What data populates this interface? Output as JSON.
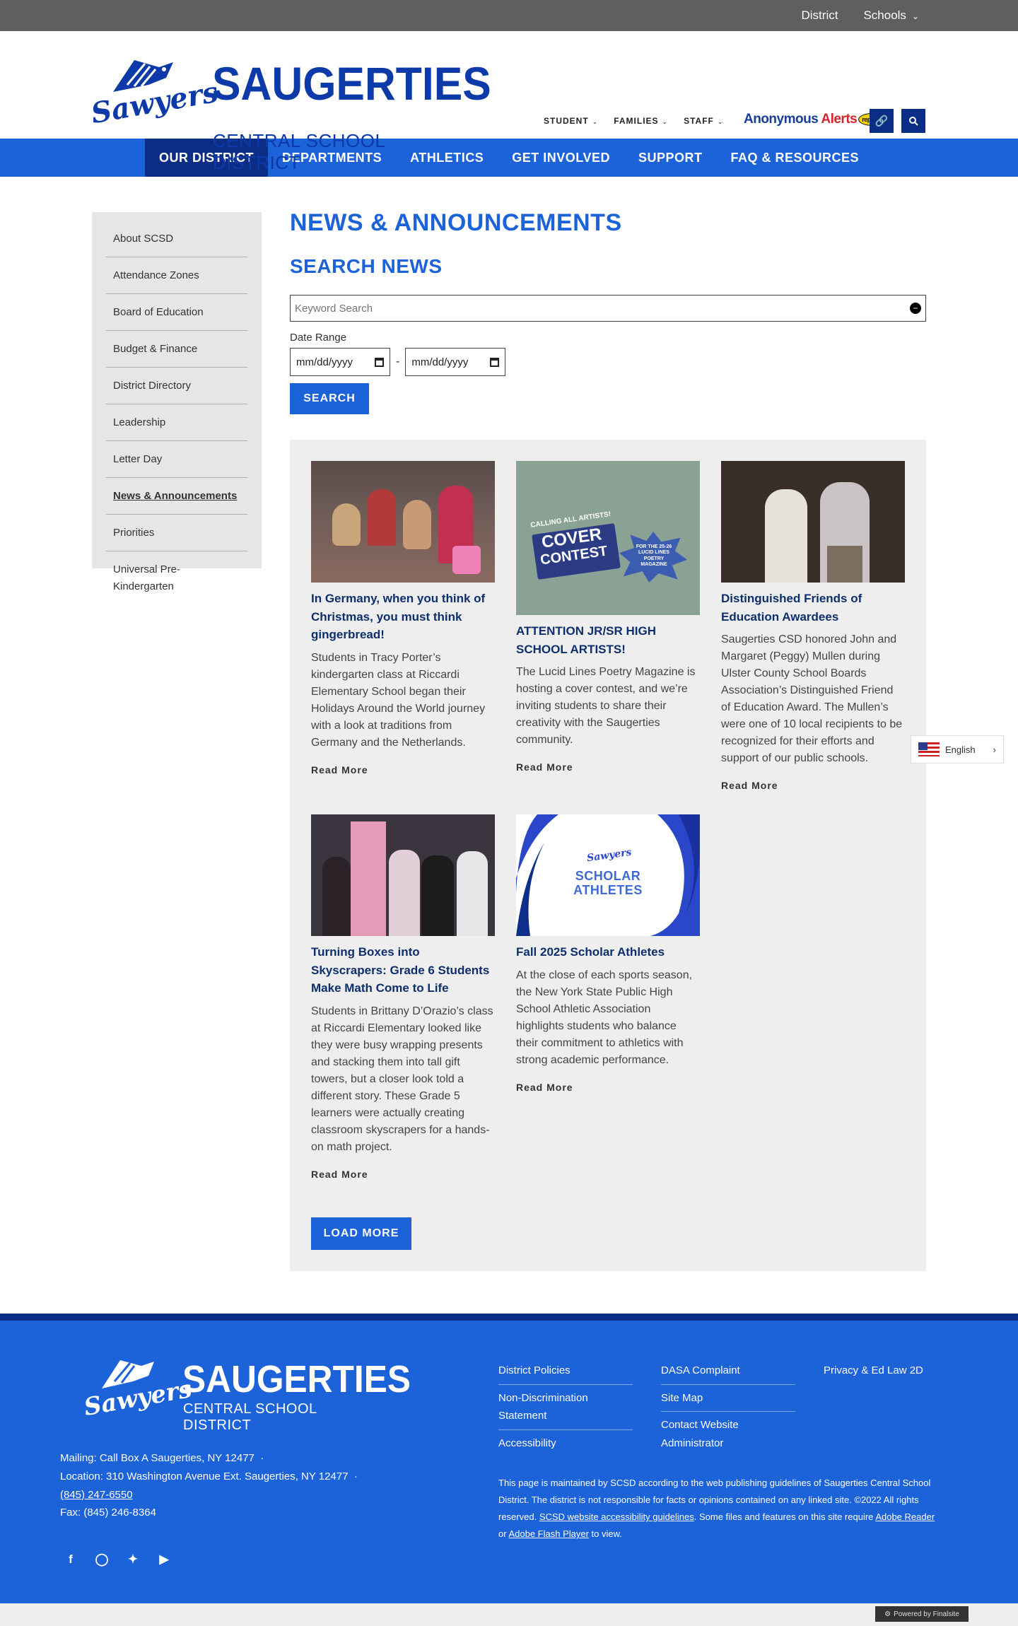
{
  "topbar": {
    "district": "District",
    "schools": "Schools"
  },
  "logo": {
    "script": "Sawyers",
    "title": "SAUGERTIES",
    "subtitle": "CENTRAL SCHOOL DISTRICT"
  },
  "header_nav": {
    "student": "STUDENT",
    "families": "FAMILIES",
    "staff": "STAFF"
  },
  "anonymous_alerts": {
    "part1": "Anonymous ",
    "part2": "Alerts",
    "badge": "report it"
  },
  "main_nav": [
    "OUR DISTRICT",
    "DEPARTMENTS",
    "ATHLETICS",
    "GET INVOLVED",
    "SUPPORT",
    "FAQ & RESOURCES"
  ],
  "sidebar": {
    "items": [
      "About SCSD",
      "Attendance Zones",
      "Board of Education",
      "Budget & Finance",
      "District Directory",
      "Leadership",
      "Letter Day",
      "News & Announcements",
      "Priorities",
      "Universal Pre-Kindergarten"
    ],
    "active_index": 7
  },
  "page": {
    "title": "NEWS & ANNOUNCEMENTS",
    "search_heading": "SEARCH NEWS"
  },
  "search": {
    "placeholder": "Keyword Search",
    "date_range_label": "Date Range",
    "date_from": "mm/dd/yyyy",
    "date_sep": "-",
    "date_to": "mm/dd/yyyy",
    "button": "SEARCH"
  },
  "news": [
    {
      "title": "In Germany, when you think of Christmas, you must think gingerbread!",
      "body": "Students in Tracy Porter’s kindergarten class at Riccardi Elementary School began their Holidays Around the World journey with a look at traditions from Germany and the Netherlands.",
      "more": "Read More"
    },
    {
      "title": "ATTENTION JR/SR HIGH SCHOOL ARTISTS!",
      "body": "The Lucid Lines Poetry Magazine is hosting a cover contest, and we’re inviting students to share their creativity with the Saugerties community.",
      "more": "Read More",
      "img_text": {
        "calling": "CALLING ALL ARTISTS!",
        "cover": "COVER",
        "contest": "CONTEST",
        "for": "FOR THE 25-26",
        "mag1": "LUCID LINES",
        "mag2": "POETRY",
        "mag3": "MAGAZINE"
      }
    },
    {
      "title": "Distinguished Friends of Education Awardees",
      "body": "Saugerties CSD honored John and Margaret (Peggy) Mullen during Ulster County School Boards Association’s Distinguished Friend of Education Award. The Mullen’s were one of 10 local recipients to be recognized for their efforts and support of our public schools.",
      "more": "Read More"
    },
    {
      "title": "Turning Boxes into Skyscrapers: Grade 6 Students Make Math Come to Life",
      "body": "Students in Brittany D’Orazio’s class at Riccardi Elementary looked like they were busy wrapping presents and stacking them into tall gift towers, but a closer look told a different story. These Grade 5 learners were actually creating classroom skyscrapers for a hands-on math project.",
      "more": "Read More"
    },
    {
      "title": "Fall 2025 Scholar Athletes",
      "body": "At the close of each sports season, the New York State Public High School Athletic Association highlights students who balance their commitment to athletics with strong academic performance.",
      "more": "Read More",
      "img_text": {
        "script": "Sawyers",
        "line1": "SCHOLAR",
        "line2": "ATHLETES"
      }
    }
  ],
  "load_more": "LOAD MORE",
  "language": "English",
  "footer": {
    "logo_script": "Sawyers",
    "logo_title": "SAUGERTIES",
    "logo_subtitle": "CENTRAL SCHOOL DISTRICT",
    "mailing": "Mailing: Call Box A Saugerties, NY 12477",
    "location": "Location: 310 Washington Avenue Ext. Saugerties, NY 12477",
    "phone": "(845) 247-6550",
    "fax": "Fax: (845) 246-8364",
    "col1": [
      "District Policies",
      "Non-Discrimination Statement",
      "Accessibility"
    ],
    "col2": [
      "DASA Complaint",
      "Site Map",
      "Contact Website Administrator"
    ],
    "col3": [
      "Privacy & Ed Law 2D"
    ],
    "note_1": "This page is maintained by SCSD according to the web publishing guidelines of Saugerties Central School District. The district is not responsible for facts or opinions contained on any linked site. ©2022 All rights reserved.",
    "note_link1": "SCSD website accessibility guidelines",
    "note_2": ". Some files and features on this site require",
    "note_link2": "Adobe Reader",
    "note_3": "or",
    "note_link3": "Adobe Flash Player",
    "note_4": "to view."
  },
  "powered_by": "Powered by Finalsite"
}
